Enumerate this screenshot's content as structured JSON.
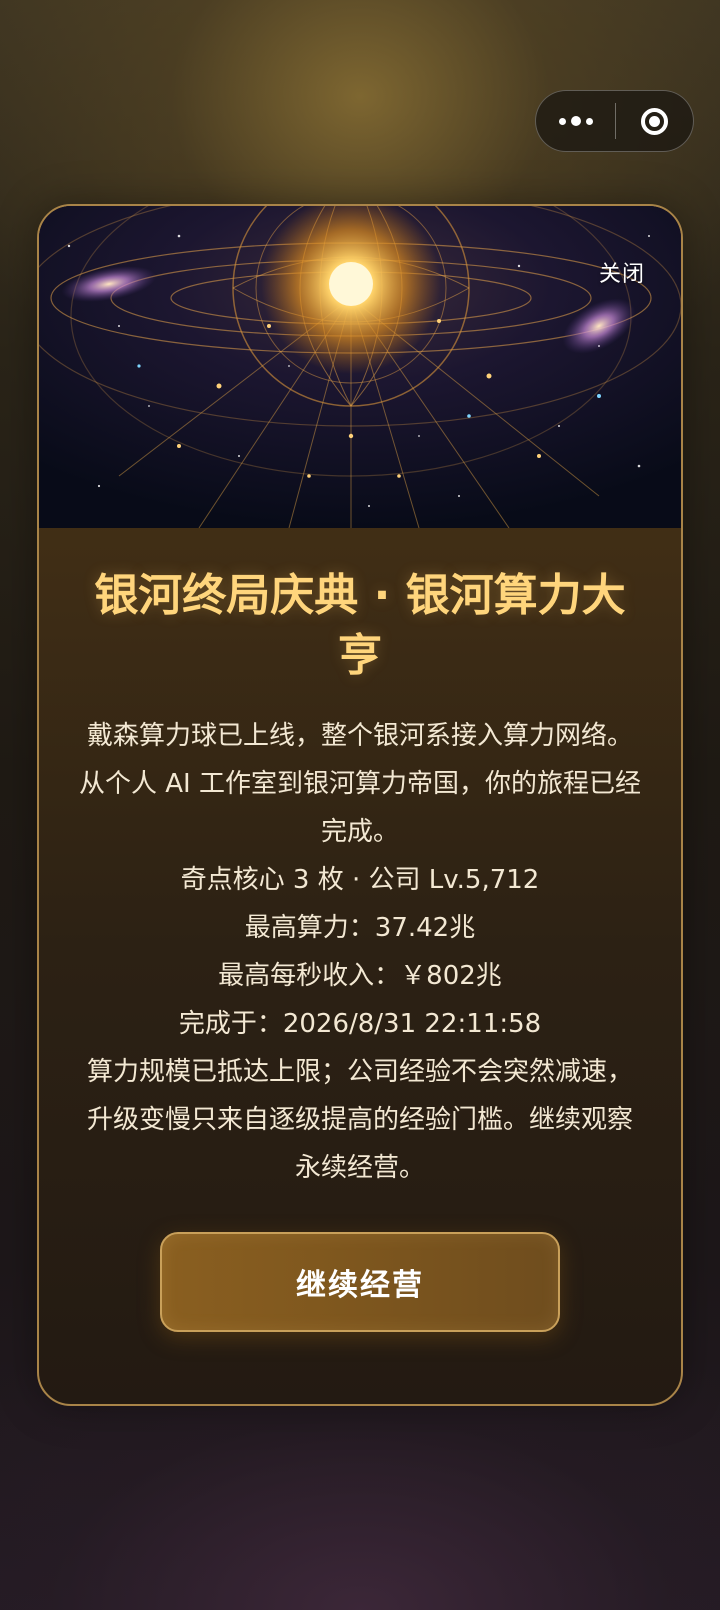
{
  "capsule": {
    "more_icon": "more-dots-icon",
    "close_icon": "target-close-icon"
  },
  "modal": {
    "close_label": "关闭",
    "title": "银河终局庆典 · 银河算力大亨",
    "lines": [
      "戴森算力球已上线，整个银河系接入算力网络。",
      "从个人 AI 工作室到银河算力帝国，你的旅程已经完成。",
      "奇点核心 3 枚 · 公司 Lv.5,712",
      "最高算力：37.42兆",
      "最高每秒收入：￥802兆",
      "完成于：2026/8/31 22:11:58",
      "算力规模已抵达上限；公司经验不会突然减速，升级变慢只来自逐级提高的经验门槛。继续观察永续经营。"
    ],
    "button_label": "继续经营"
  },
  "colors": {
    "title": "#ffd57c",
    "border": "#a98448",
    "button": "#8a5f20"
  }
}
